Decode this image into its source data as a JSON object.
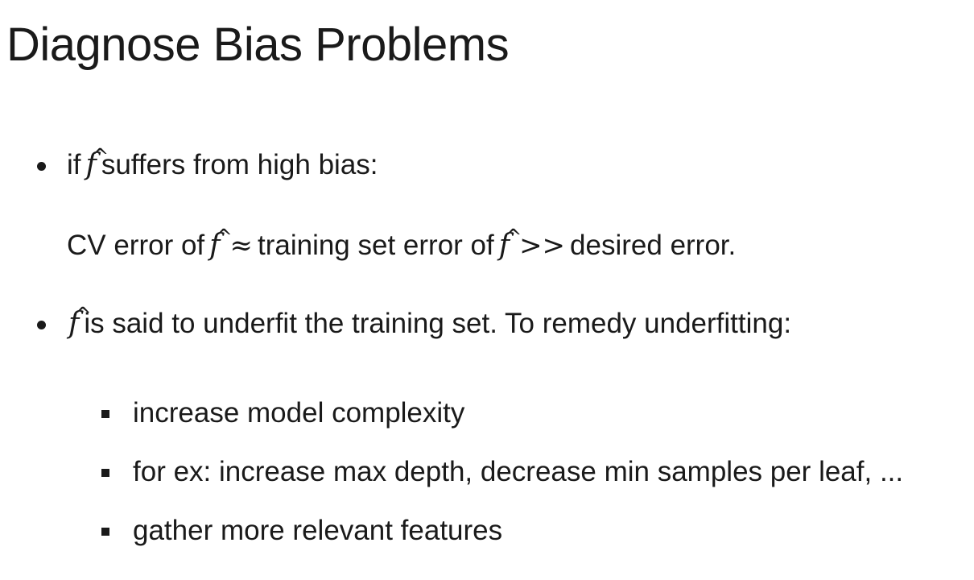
{
  "title": "Diagnose Bias Problems",
  "bullets": [
    {
      "prefix": "if",
      "symbol": "f",
      "hat": "^",
      "suffix": "suffers from high bias:"
    },
    {
      "symbol": "f",
      "hat": "^",
      "text": "is said to underfit the training set. To remedy underfitting:"
    }
  ],
  "continuation": {
    "part1": "CV error of",
    "symbol1": "f",
    "hat1": "^",
    "approx": "≈",
    "part2": "training set error of",
    "symbol2": "f",
    "hat2": "^",
    "gtgt": ">>",
    "part3": "desired error."
  },
  "sub_bullets": [
    "increase model complexity",
    "for ex: increase max depth, decrease min samples per leaf, ...",
    "gather more relevant features"
  ]
}
